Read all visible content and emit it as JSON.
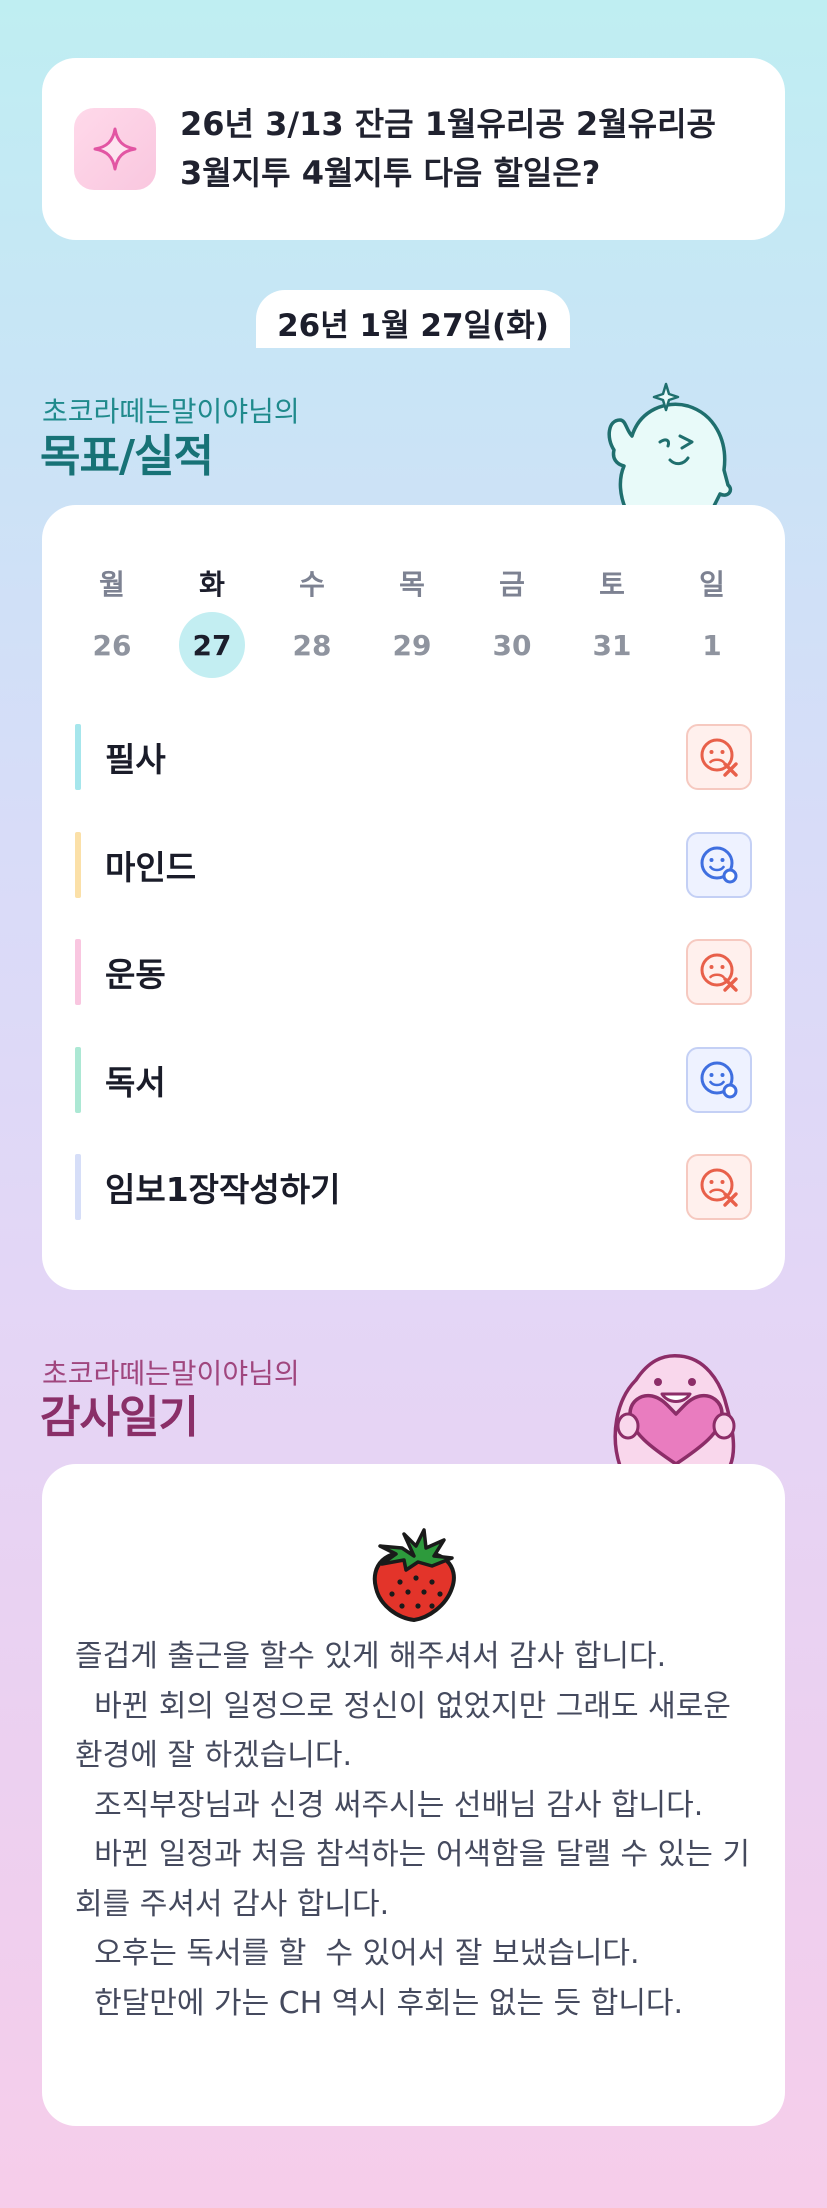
{
  "question": {
    "icon": "sparkle-icon",
    "text": "26년 3/13 잔금 1월유리공 2월유리공 3월지투 4월지투 다음 할일은?"
  },
  "date_label": "26년 1월 27일(화)",
  "goals_section": {
    "subtitle": "초코라떼는말이야님의",
    "title": "목표/실적"
  },
  "week": {
    "days": [
      "월",
      "화",
      "수",
      "목",
      "금",
      "토",
      "일"
    ],
    "dates": [
      "26",
      "27",
      "28",
      "29",
      "30",
      "31",
      "1"
    ],
    "selected_index": 1
  },
  "goals": [
    {
      "label": "필사",
      "status": "sad-x-icon",
      "bar_color": "#a6e6ec"
    },
    {
      "label": "마인드",
      "status": "smile-check-icon",
      "bar_color": "#fbe0a8"
    },
    {
      "label": "운동",
      "status": "sad-x-icon",
      "bar_color": "#f9c6e0"
    },
    {
      "label": "독서",
      "status": "smile-check-icon",
      "bar_color": "#ace8d4"
    },
    {
      "label": "임보1장작성하기",
      "status": "sad-x-icon",
      "bar_color": "#d6def8"
    }
  ],
  "thanks_section": {
    "subtitle": "초코라떼는말이야님의",
    "title": "감사일기",
    "icon": "strawberry-icon",
    "body": "즐겁게 출근을 할수 있게 해주셔서 감사 합니다.\n  바뀐 회의 일정으로 정신이 없었지만 그래도 새로운 환경에 잘 하겠습니다.\n  조직부장님과 신경 써주시는 선배님 감사 합니다.\n  바뀐 일정과 처음 참석하는 어색함을 달랠 수 있는 기회를 주셔서 감사 합니다.\n  오후는 독서를 할  수 있어서 잘 보냈습니다.\n  한달만에 가는 CH 역시 후회는 없는 듯 합니다."
  },
  "colors": {
    "goal_title": "#177276",
    "thanks_title": "#8a2f68",
    "bad_status": "#e8604a",
    "good_status": "#3f6fe0"
  }
}
